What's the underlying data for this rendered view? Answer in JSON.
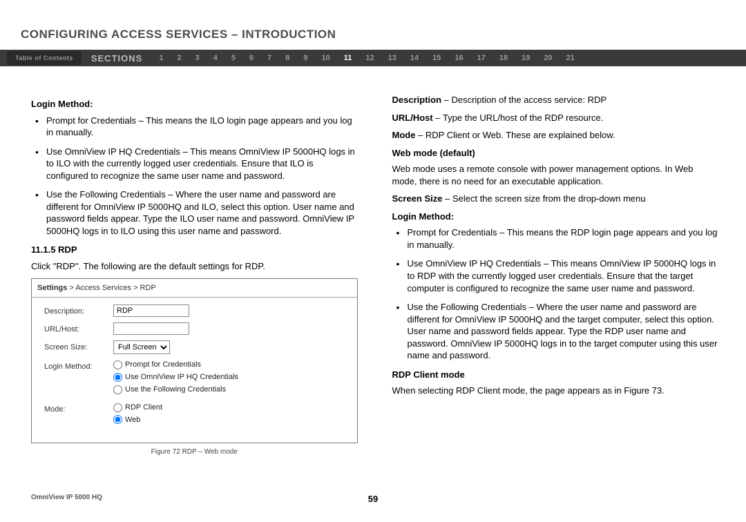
{
  "title": "CONFIGURING ACCESS SERVICES – INTRODUCTION",
  "nav": {
    "toc": "Table of Contents",
    "sections": "SECTIONS",
    "numbers": [
      "1",
      "2",
      "3",
      "4",
      "5",
      "6",
      "7",
      "8",
      "9",
      "10",
      "11",
      "12",
      "13",
      "14",
      "15",
      "16",
      "17",
      "18",
      "19",
      "20",
      "21"
    ],
    "active": "11"
  },
  "left": {
    "h1": "Login Method:",
    "bullets": [
      "Prompt for Credentials – This means the ILO login page appears and you log in manually.",
      "Use OmniView IP HQ Credentials – This means OmniView IP 5000HQ logs in to ILO with the currently logged user credentials. Ensure that ILO is configured to recognize the same user name and password.",
      "Use the Following Credentials – Where the user name and password are different for OmniView IP 5000HQ and ILO, select this option. User name and password fields appear. Type the ILO user name and password. OmniView IP 5000HQ logs in to ILO using this user name and password."
    ],
    "h2": "11.1.5 RDP",
    "intro": "Click \"RDP\". The following are the default settings for RDP.",
    "breadcrumb_bold": "Settings",
    "breadcrumb_rest": " > Access Services > RDP",
    "form": {
      "description_label": "Description:",
      "description_value": "RDP",
      "url_label": "URL/Host:",
      "url_value": "",
      "screen_label": "Screen Size:",
      "screen_value": "Full Screen",
      "login_label": "Login Method:",
      "login_opts": [
        "Prompt for Credentials",
        "Use OmniView IP HQ Credentials",
        "Use the Following Credentials"
      ],
      "login_selected": 1,
      "mode_label": "Mode:",
      "mode_opts": [
        "RDP Client",
        "Web"
      ],
      "mode_selected": 1
    },
    "figcaption": "Figure 72 RDP – Web mode"
  },
  "right": {
    "p1a": "Description",
    "p1b": " – Description of the access service: RDP",
    "p2a": "URL/Host",
    "p2b": " – Type the URL/host of the RDP resource.",
    "p3a": "Mode",
    "p3b": " – RDP Client or Web. These are explained below.",
    "h1": "Web mode (default)",
    "p4": "Web mode uses a remote console with power management options. In Web mode, there is no need for an executable application.",
    "p5a": "Screen Size",
    "p5b": " – Select the screen size from the drop-down menu",
    "h2": "Login Method:",
    "bullets": [
      "Prompt for Credentials – This means the RDP login page appears and you log in manually.",
      "Use OmniView IP HQ Credentials – This means OmniView IP 5000HQ logs in to RDP with the currently logged user credentials. Ensure that the target computer is configured to recognize the same user name and password.",
      "Use the Following Credentials – Where the user name and password are different for OmniView IP 5000HQ and the target computer, select this option. User name and password fields appear. Type the RDP user name and password. OmniView IP 5000HQ logs in to the target computer using this user name and password."
    ],
    "h3": "RDP Client mode",
    "p6": "When selecting RDP Client mode, the page appears as in Figure 73."
  },
  "footer": {
    "product": "OmniView IP 5000 HQ",
    "page": "59"
  }
}
